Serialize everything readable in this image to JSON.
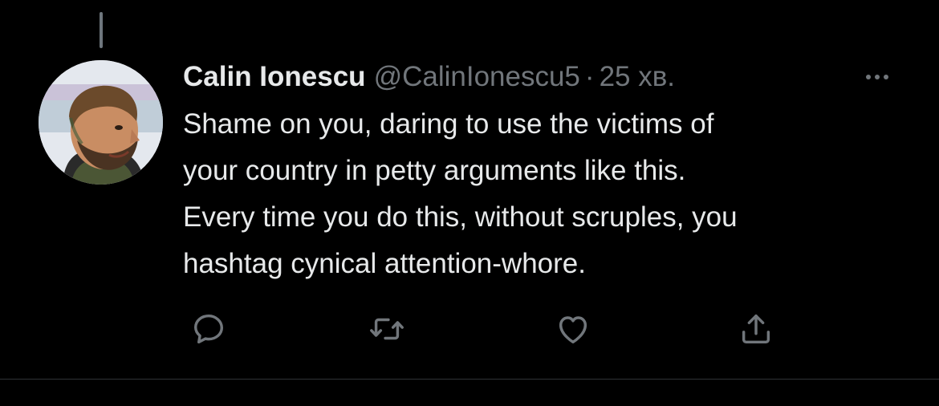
{
  "tweet": {
    "display_name": "Calin Ionescu",
    "handle": "@CalinIonescu5",
    "separator": "·",
    "timestamp": "25 хв.",
    "text_lines": [
      "Shame on you, daring to use the victims of",
      "your country in petty arguments like this.",
      "Every time you do this, without scruples, you",
      "hashtag cynical attention-whore."
    ]
  },
  "actions": [
    {
      "name": "reply",
      "icon": "reply-icon"
    },
    {
      "name": "retweet",
      "icon": "retweet-icon"
    },
    {
      "name": "like",
      "icon": "heart-icon"
    },
    {
      "name": "share",
      "icon": "share-icon"
    }
  ],
  "colors": {
    "background": "#000000",
    "primary_text": "#e7e9ea",
    "secondary_text": "#71767b",
    "divider": "#2f3336"
  }
}
